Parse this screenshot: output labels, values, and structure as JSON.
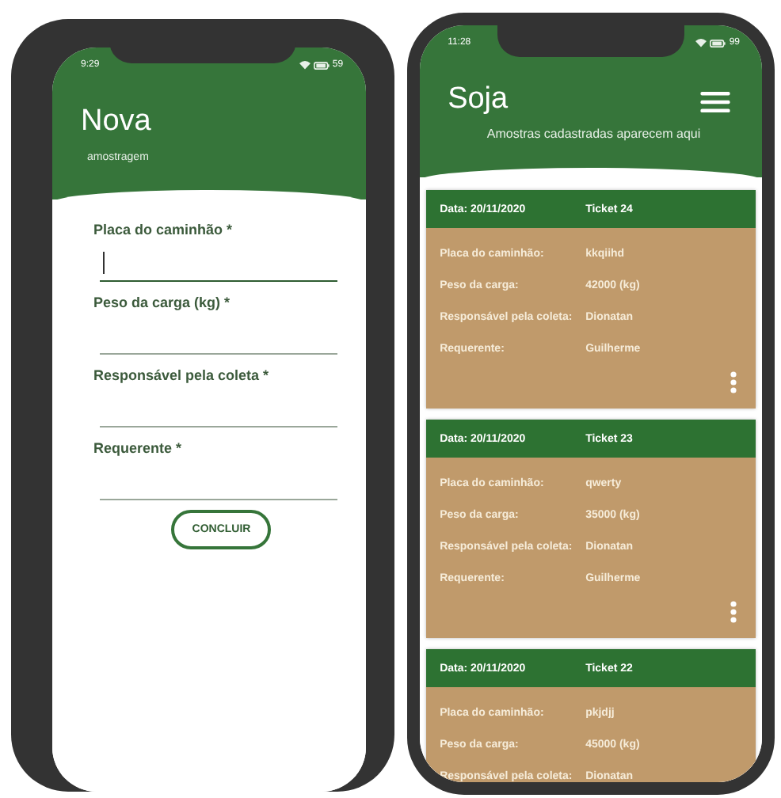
{
  "phones": [
    {
      "kind": "form",
      "status": {
        "time": "9:29",
        "battery": "59"
      },
      "title": "Nova",
      "subtitle": "amostragem",
      "fields": [
        {
          "label": "Placa do caminhão *",
          "focused": true
        },
        {
          "label": "Peso da carga (kg) *",
          "focused": false
        },
        {
          "label": "Responsável pela coleta *",
          "focused": false
        },
        {
          "label": "Requerente *",
          "focused": false
        }
      ],
      "button": "CONCLUIR"
    },
    {
      "kind": "list",
      "status": {
        "time": "11:28",
        "battery": "99"
      },
      "title": "Soja",
      "subtitle": "Amostras cadastradas aparecem aqui",
      "cards": [
        {
          "date": "Data: 20/11/2020",
          "ticket": "Ticket 24",
          "rows": [
            {
              "label": "Placa do caminhão:",
              "value": "kkqiihd"
            },
            {
              "label": "Peso da carga:",
              "value": "42000 (kg)"
            },
            {
              "label": "Responsável pela coleta:",
              "value": "Dionatan"
            },
            {
              "label": "Requerente:",
              "value": "Guilherme"
            }
          ],
          "menu": true
        },
        {
          "date": "Data: 20/11/2020",
          "ticket": "Ticket 23",
          "rows": [
            {
              "label": "Placa do caminhão:",
              "value": "qwerty"
            },
            {
              "label": "Peso da carga:",
              "value": "35000 (kg)"
            },
            {
              "label": "Responsável pela coleta:",
              "value": "Dionatan"
            },
            {
              "label": "Requerente:",
              "value": "Guilherme"
            }
          ],
          "menu": true
        },
        {
          "date": "Data: 20/11/2020",
          "ticket": "Ticket 22",
          "rows": [
            {
              "label": "Placa do caminhão:",
              "value": "pkjdjj"
            },
            {
              "label": "Peso da carga:",
              "value": "45000 (kg)"
            },
            {
              "label": "Responsável pela coleta:",
              "value": "Dionatan"
            }
          ],
          "menu": false
        }
      ]
    }
  ]
}
